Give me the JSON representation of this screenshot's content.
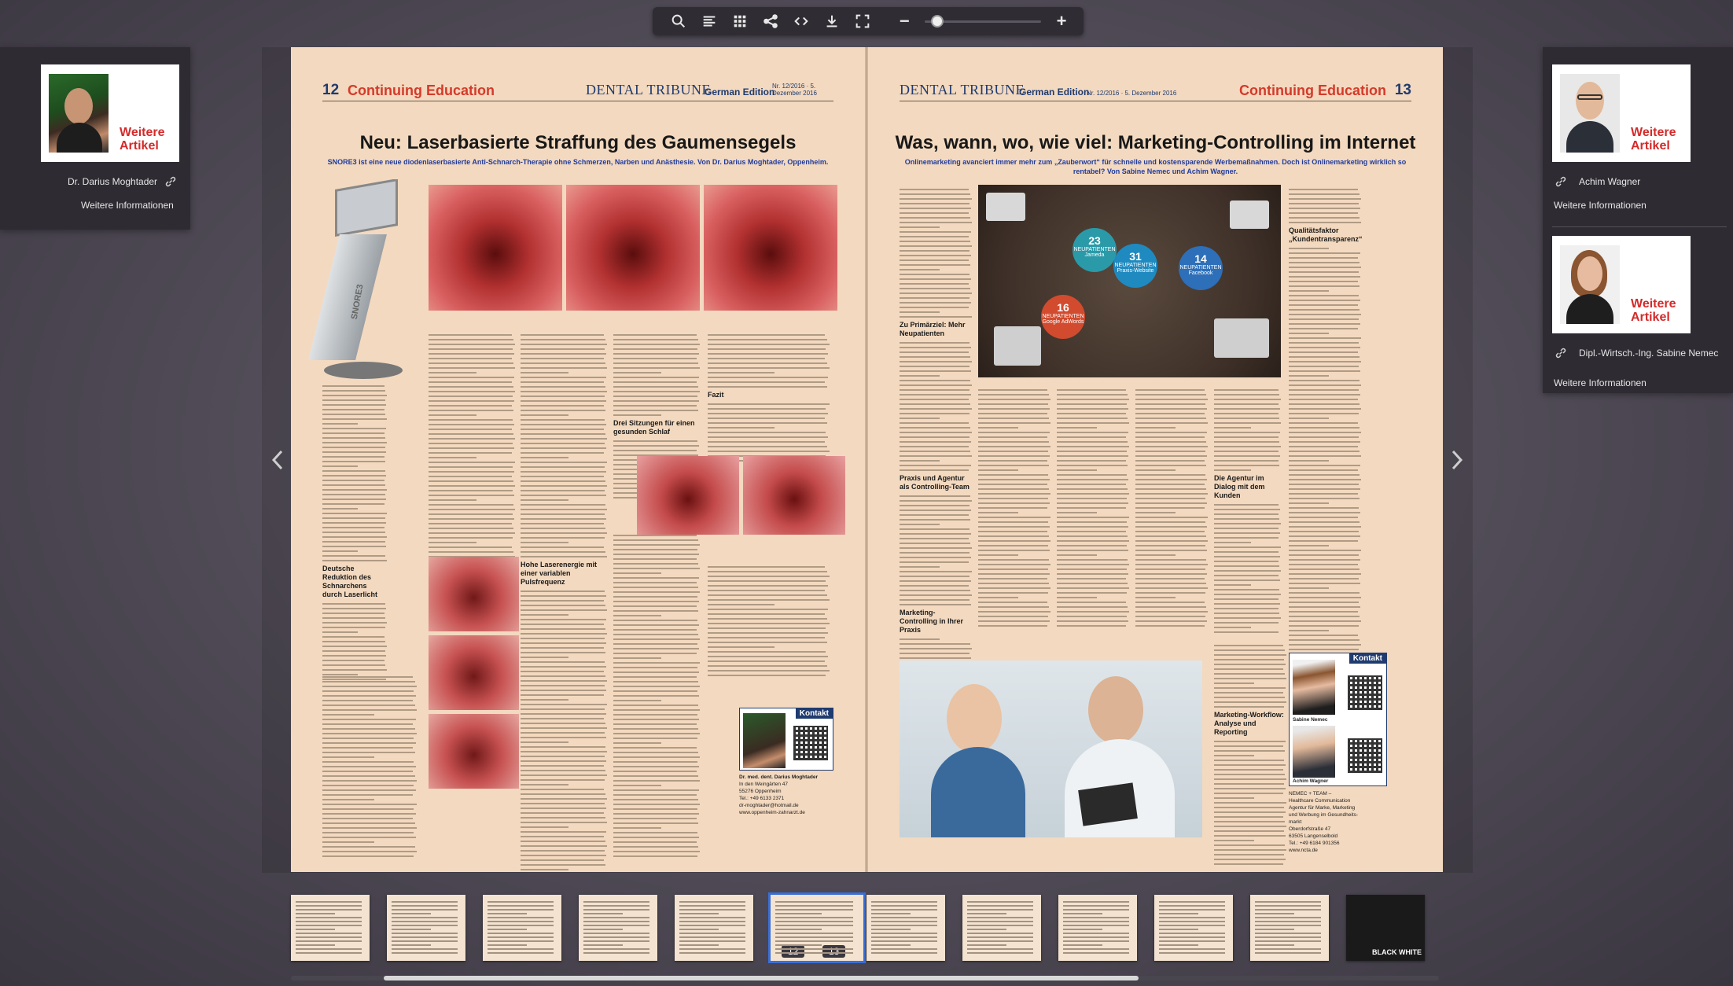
{
  "toolbar": {
    "icons": [
      "search-icon",
      "toc-icon",
      "grid-icon",
      "share-icon",
      "embed-icon",
      "download-icon",
      "fullscreen-icon",
      "zoom-out-icon",
      "zoom-in-icon"
    ],
    "zoom_minus": "−",
    "zoom_plus": "+",
    "zoom_level": 0.04
  },
  "left_panel": {
    "more_label": "Weitere\nArtikel",
    "author": "Dr. Darius Moghtader",
    "info_link": "Weitere Informationen"
  },
  "right_panel": {
    "cards": [
      {
        "more_label": "Weitere\nArtikel",
        "author": "Achim Wagner",
        "info_link": "Weitere Informationen"
      },
      {
        "more_label": "Weitere\nArtikel",
        "author": "Dipl.-Wirtsch.-Ing. Sabine Nemec",
        "info_link": "Weitere Informationen"
      }
    ]
  },
  "left_page": {
    "page_number": "12",
    "section": "Continuing Education",
    "masthead": "DENTAL TRIBUNE",
    "edition": "German Edition",
    "issue": "Nr. 12/2016 · 5. Dezember 2016",
    "headline": "Neu: Laserbasierte Straffung des Gaumensegels",
    "subhead": "SNORE3 ist eine neue diodenlaserbasierte Anti-Schnarch-Therapie ohne Schmerzen, Narben und Anästhesie. Von Dr. Darius Moghtader, Oppenheim.",
    "device_label": "SNORE3",
    "subtitles": [
      "Deutsche Reduktion des Schnarchens durch Laserlicht",
      "Drei Sitzungen für einen gesunden Schlaf",
      "Fazit",
      "Hohe Laserenergie mit einer variablen Pulsfrequenz"
    ],
    "contact_title": "Kontakt",
    "contact_name": "Dr. med. dent. Darius Moghtader",
    "contact_lines": [
      "In den Weingärten 47",
      "55276 Oppenheim",
      "Tel.: +49 6133 2371",
      "dr-moghtader@hotmail.de",
      "www.oppenheim-zahnarzt.de"
    ]
  },
  "right_page": {
    "page_number": "13",
    "section": "Continuing Education",
    "masthead": "DENTAL TRIBUNE",
    "edition": "German Edition",
    "issue": "Nr. 12/2016 · 5. Dezember 2016",
    "headline": "Was, wann, wo, wie viel: Marketing-Controlling im Internet",
    "subhead": "Onlinemarketing avanciert immer mehr zum „Zauberwort“ für schnelle und kostensparende Werbemaßnahmen. Doch ist Onlinemarketing wirklich so rentabel? Von Sabine Nemec und Achim Wagner.",
    "bubbles": [
      {
        "num": "23",
        "label": "NEUPATIENTEN",
        "src": "Jameda"
      },
      {
        "num": "31",
        "label": "NEUPATIENTEN",
        "src": "Praxis-Website"
      },
      {
        "num": "14",
        "label": "NEUPATIENTEN",
        "src": "Facebook"
      },
      {
        "num": "16",
        "label": "NEUPATIENTEN",
        "src": "Google AdWords"
      }
    ],
    "subtitles": [
      "Zu Primärziel: Mehr Neupatienten",
      "Praxis und Agentur als Controlling-Team",
      "Marketing-Controlling in Ihrer Praxis",
      "Qualitätsfaktor „Kundentransparenz“",
      "Die Agentur im Dialog mit dem Kunden",
      "Marketing-Workflow: Analyse und Reporting"
    ],
    "contact_title": "Kontakt",
    "contact_names": [
      "Sabine Nemec",
      "Achim Wagner"
    ],
    "contact_lines": [
      "NEMEC + TEAM –",
      "Healthcare Communication",
      "Agentur für Marke, Marketing",
      "und Werbung im Gesundheits-",
      "markt",
      "Oberdorfstraße 47",
      "63505 Langenselbold",
      "Tel.: +49 6184 901356",
      "www.ncta.de"
    ]
  },
  "thumbnails": {
    "count": 12,
    "active_labels": [
      "12",
      "13"
    ],
    "last_label": "BLACK WHITE"
  },
  "colors": {
    "page": "#f3d9bf",
    "accent_red": "#d43a2a",
    "accent_blue": "#1f3b6f",
    "active_thumb": "#3a6fd8"
  }
}
